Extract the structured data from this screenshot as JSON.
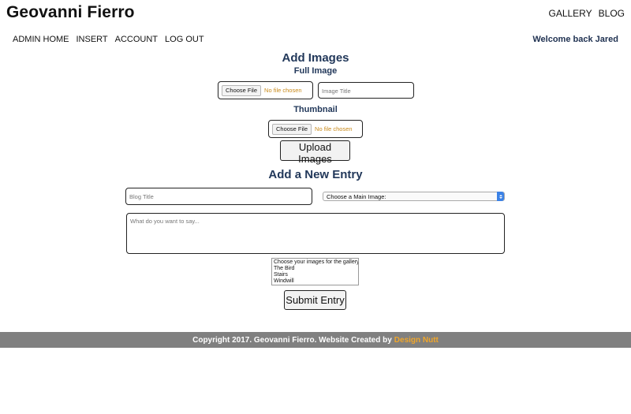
{
  "site": {
    "title": "Geovanni Fierro"
  },
  "top_nav": {
    "gallery": "GALLERY",
    "blog": "BLOG"
  },
  "admin_nav": {
    "home": "ADMIN HOME",
    "insert": "INSERT",
    "account": "ACCOUNT",
    "logout": "LOG OUT"
  },
  "welcome": "Welcome back Jared",
  "add_images": {
    "heading": "Add Images",
    "full_label": "Full Image",
    "thumb_label": "Thumbnail",
    "choose_file": "Choose File",
    "no_file": "No file chosen",
    "title_placeholder": "Image Title",
    "upload_button": "Upload Images"
  },
  "new_entry": {
    "heading": "Add a New Entry",
    "title_placeholder": "Blog Title",
    "main_image_select": "Choose a Main Image:",
    "body_placeholder": "What do you want to say...",
    "gallery_options": [
      "Choose your images for the gallery:",
      "The Bird",
      "Stairs",
      "Windwill"
    ],
    "submit_button": "Submit Entry"
  },
  "footer": {
    "text": "Copyright 2017. Geovanni Fierro. Website Created by",
    "link": "Design Nutt"
  },
  "colors": {
    "heading": "#22385a",
    "accent_orange": "#f0a62a",
    "footer_bg": "#808080",
    "select_blue": "#3c82e6"
  }
}
